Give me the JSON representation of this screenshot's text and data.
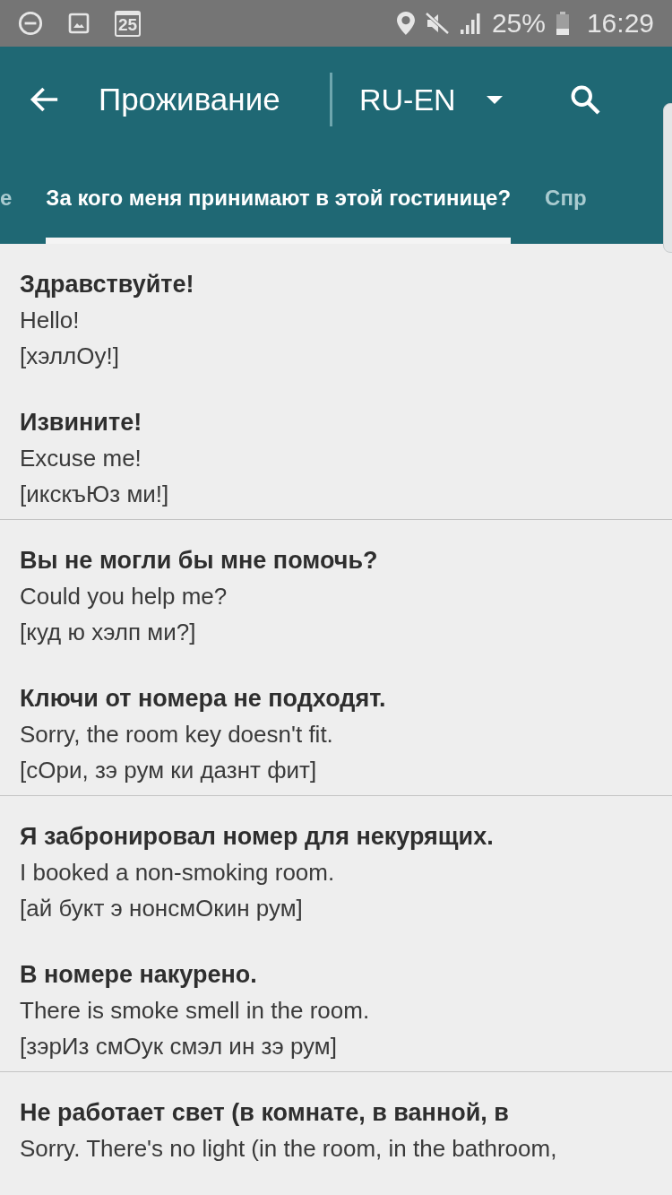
{
  "status_bar": {
    "calendar_day": "25",
    "battery_percent": "25%",
    "time": "16:29"
  },
  "toolbar": {
    "title": "Проживание",
    "language_pair": "RU-EN"
  },
  "tabs": [
    {
      "label": "е",
      "selected": false
    },
    {
      "label": "За кого меня принимают в этой гостинице?",
      "selected": true
    },
    {
      "label": "Спр",
      "selected": false
    }
  ],
  "phrase_groups": [
    {
      "phrases": [
        {
          "ru": "Здравствуйте!",
          "en": "Hello!",
          "transcription": "[хэллОу!]"
        },
        {
          "ru": "Извините!",
          "en": "Excuse me!",
          "transcription": "[икскъЮз ми!]"
        }
      ]
    },
    {
      "phrases": [
        {
          "ru": "Вы не могли бы мне помочь?",
          "en": "Could you help me?",
          "transcription": "[куд ю хэлп ми?]"
        },
        {
          "ru": "Ключи от номера не подходят.",
          "en": "Sorry, the room key doesn't fit.",
          "transcription": "[сОри, зэ рум ки дазнт фит]"
        }
      ]
    },
    {
      "phrases": [
        {
          "ru": "Я забронировал номер для некурящих.",
          "en": "I booked a non-smoking room.",
          "transcription": "[ай букт э нонсмОкин рум]"
        },
        {
          "ru": "В номере накурено.",
          "en": "There is smoke smell in the room.",
          "transcription": "[зэрИз смОук смэл ин зэ рум]"
        }
      ]
    },
    {
      "phrases": [
        {
          "ru": "Не работает свет (в комнате, в ванной, в",
          "en": "Sorry. There's no light (in the room, in the bathroom,"
        }
      ]
    }
  ]
}
